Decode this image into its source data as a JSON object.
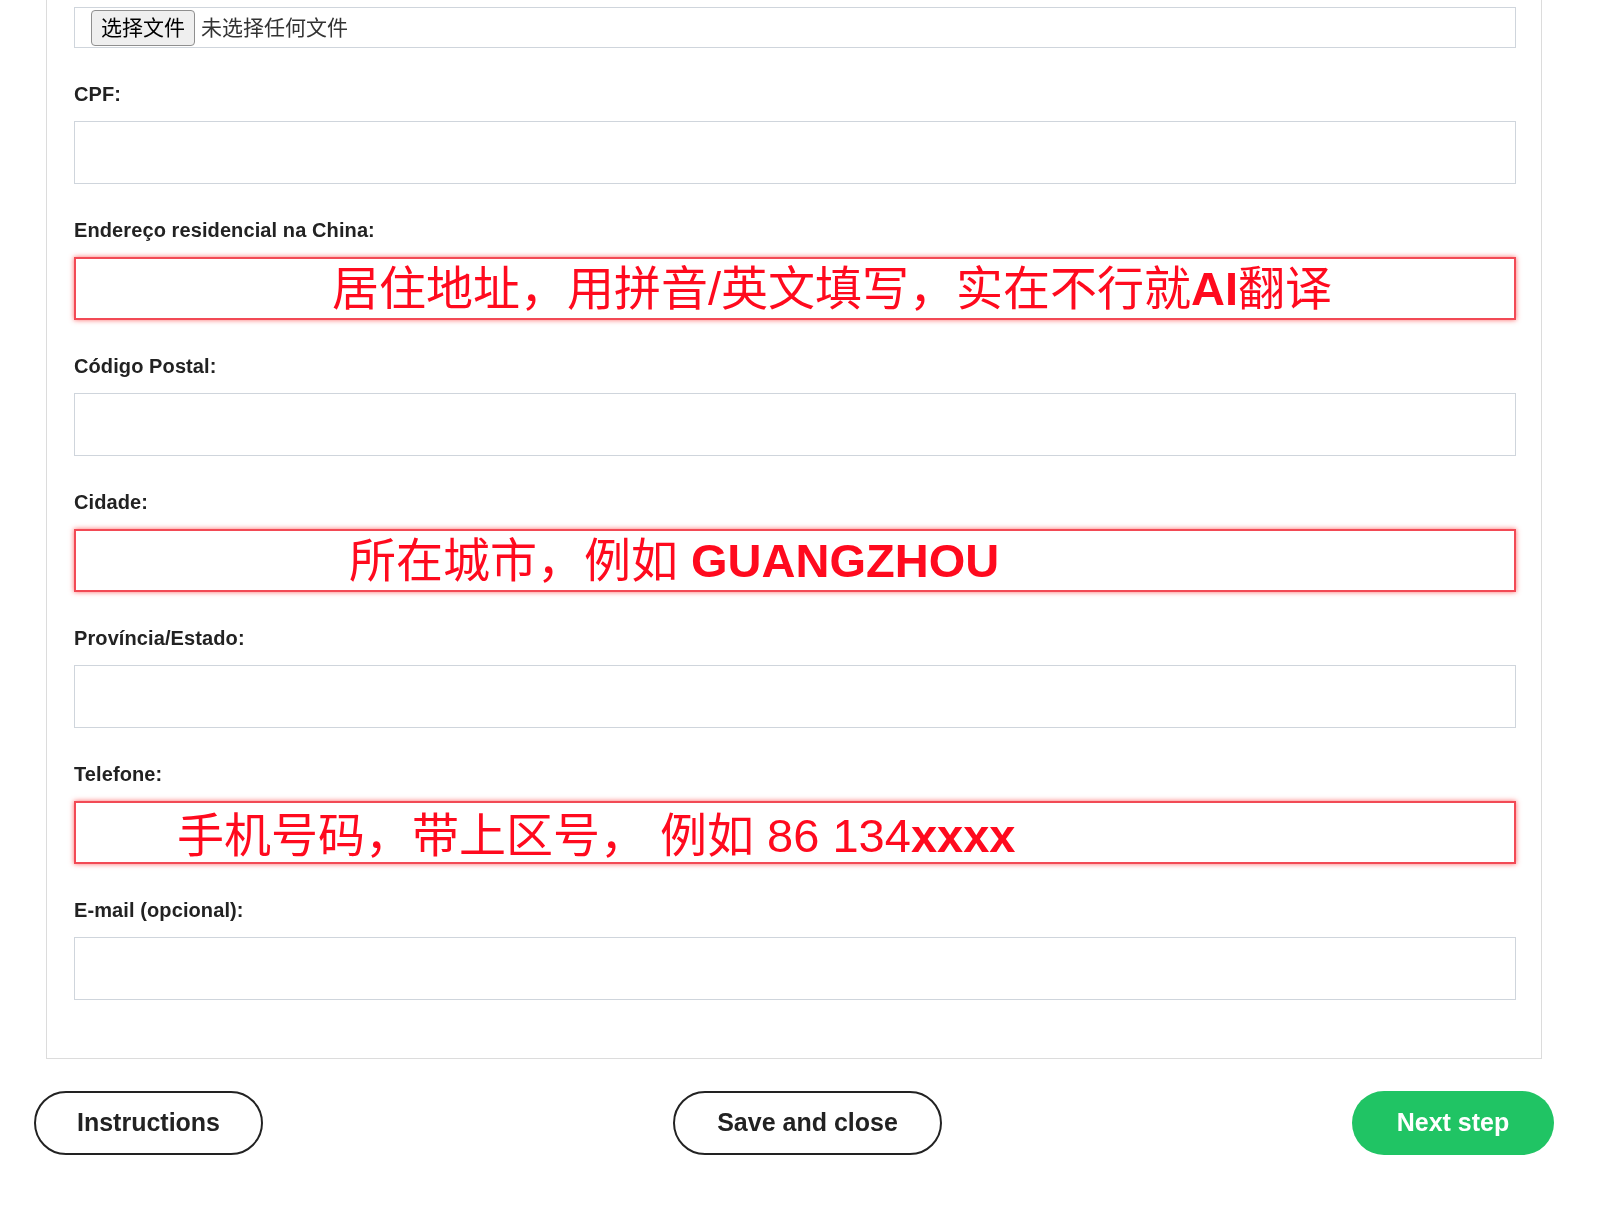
{
  "file_input": {
    "button": "选择文件",
    "status": "未选择任何文件"
  },
  "fields": [
    {
      "label": "CPF:",
      "highlighted": false
    },
    {
      "label": "Endereço residencial na China:",
      "highlighted": true,
      "annotation": "居住地址，用拼音/英文填写，实在不行就**AI**翻译"
    },
    {
      "label": "Código Postal:",
      "highlighted": false
    },
    {
      "label": "Cidade:",
      "highlighted": true,
      "annotation": "所在城市，例如 **GUANGZHOU**"
    },
    {
      "label": "Província/Estado:",
      "highlighted": false
    },
    {
      "label": "Telefone:",
      "highlighted": true,
      "annotation": "手机号码，带上区号， 例如 86 134**xxxx**"
    },
    {
      "label": "E-mail (opcional):",
      "highlighted": false
    }
  ],
  "buttons": [
    {
      "label": "Instructions",
      "kind": "outline"
    },
    {
      "label": "Save and close",
      "kind": "outline"
    },
    {
      "label": "Next step",
      "kind": "primary"
    }
  ]
}
